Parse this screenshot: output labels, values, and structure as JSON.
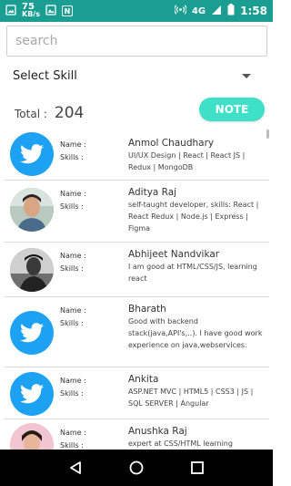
{
  "status_bar": {
    "speed_value": "75",
    "speed_unit": "KB/s",
    "notif_letter": "N",
    "network": "4G",
    "time": "1:58"
  },
  "search": {
    "placeholder": "search",
    "value": ""
  },
  "select": {
    "label": "Select Skill"
  },
  "total": {
    "label": "Total :",
    "value": "204"
  },
  "note_button": {
    "label": "NOTE"
  },
  "field_labels": {
    "name": "Name :",
    "skills": "Skills :"
  },
  "profiles": [
    {
      "name": "Anmol Chaudhary",
      "skills": "UI/UX Design | React | React JS | Redux | MongoDB",
      "avatar": "twitter-icon"
    },
    {
      "name": "Aditya Raj",
      "skills": "self-taught developer, skills: React | React Redux | Node.js | Express | Figma",
      "avatar": "photo"
    },
    {
      "name": "Abhijeet Nandvikar",
      "skills": "I am good at HTML/CSS/JS, learning react",
      "avatar": "photo"
    },
    {
      "name": "Bharath",
      "skills": "Good with backend stack(java,API's,..). I have good work experience on java,webservices.",
      "avatar": "twitter-icon"
    },
    {
      "name": "Ankita",
      "skills": "ASP.NET MVC | HTML5 | CSS3 | JS | SQL SERVER | Angular",
      "avatar": "twitter-icon"
    },
    {
      "name": "Anushka Raj",
      "skills": "expert at CSS/HTML learning",
      "avatar": "photo"
    }
  ],
  "colors": {
    "status_bar": "#1a9e92",
    "note_button": "#3ee0c8",
    "twitter": "#1da1f2",
    "nav_bar": "#000000"
  }
}
